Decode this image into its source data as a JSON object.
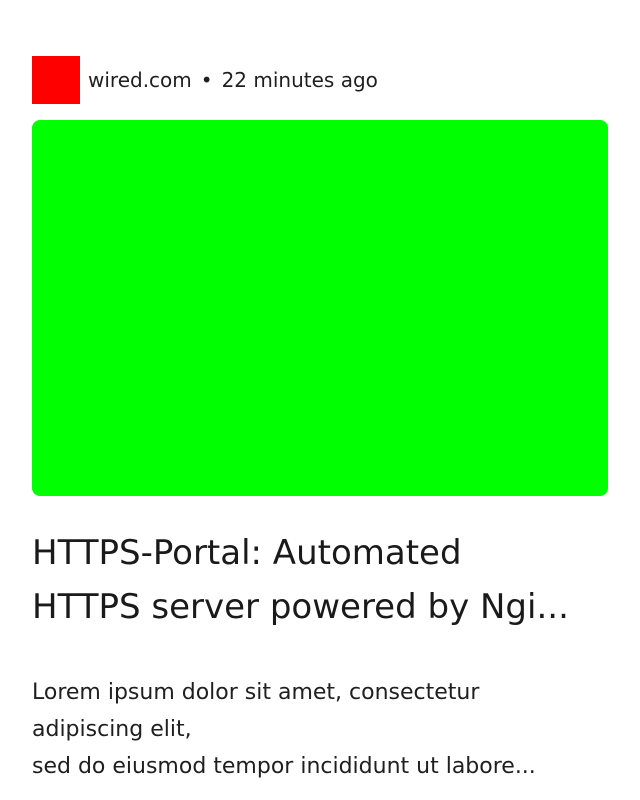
{
  "article": {
    "source": "wired.com",
    "separator": "•",
    "time": "22 minutes ago",
    "favicon_color": "#ff0000",
    "hero_color": "#00ff00",
    "headline_lines": [
      "HTTPS-Portal: Automated",
      "HTTPS server powered by Ngi..."
    ],
    "summary_lines": [
      "Lorem ipsum dolor sit amet, consectetur",
      "adipiscing elit,",
      "sed do eiusmod tempor incididunt ut labore..."
    ]
  }
}
